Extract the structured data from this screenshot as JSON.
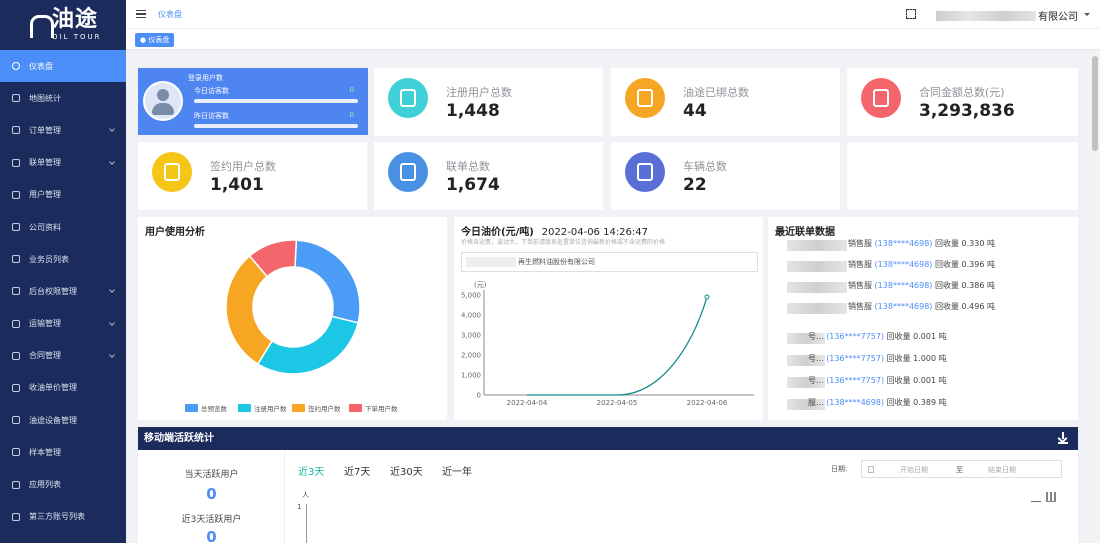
{
  "app": {
    "logo_text": "油途",
    "logo_sub": "OIL TOUR"
  },
  "sidebar": {
    "items": [
      {
        "label": "仪表盘",
        "icon": "dashboard-icon",
        "active": true,
        "expand": false
      },
      {
        "label": "地图统计",
        "icon": "map-icon",
        "expand": false
      },
      {
        "label": "订单管理",
        "icon": "order-icon",
        "expand": true
      },
      {
        "label": "联单管理",
        "icon": "manifest-icon",
        "expand": true
      },
      {
        "label": "用户管理",
        "icon": "user-icon",
        "expand": false
      },
      {
        "label": "公司资料",
        "icon": "company-icon",
        "expand": false
      },
      {
        "label": "业务员列表",
        "icon": "salesman-icon",
        "expand": false
      },
      {
        "label": "后台权限管理",
        "icon": "permission-icon",
        "expand": true
      },
      {
        "label": "运输管理",
        "icon": "truck-icon",
        "expand": true
      },
      {
        "label": "合同管理",
        "icon": "contract-icon",
        "expand": true
      },
      {
        "label": "收油单价管理",
        "icon": "price-icon",
        "expand": false
      },
      {
        "label": "油途设备管理",
        "icon": "device-icon",
        "expand": false
      },
      {
        "label": "样本管理",
        "icon": "sample-icon",
        "expand": false
      },
      {
        "label": "应用列表",
        "icon": "apps-icon",
        "expand": false
      },
      {
        "label": "第三方账号列表",
        "icon": "account-icon",
        "expand": false
      }
    ]
  },
  "header": {
    "breadcrumb": "仪表盘",
    "company_suffix": "有限公司",
    "tag": "仪表盘"
  },
  "login_card": {
    "title": "登录用户数",
    "today_label": "今日访客数",
    "today_value": "0",
    "yesterday_label": "昨日访客数",
    "yesterday_value": "0"
  },
  "stats": [
    {
      "label": "注册用户总数",
      "value": "1,448",
      "color": "#3fd0d8",
      "icon": "user-add-icon"
    },
    {
      "label": "油途已绑总数",
      "value": "44",
      "color": "#f5a623",
      "icon": "oil-drop-icon"
    },
    {
      "label": "合同金额总数(元)",
      "value": "3,293,836",
      "color": "#f4666b",
      "icon": "money-bag-icon"
    },
    {
      "label": "签约用户总数",
      "value": "1,401",
      "color": "#f5c518",
      "icon": "document-check-icon"
    },
    {
      "label": "联单总数",
      "value": "1,674",
      "color": "#4a90e2",
      "icon": "exchange-icon"
    },
    {
      "label": "车辆总数",
      "value": "22",
      "color": "#5a6fd6",
      "icon": "truck-icon"
    }
  ],
  "user_analysis": {
    "title": "用户使用分析"
  },
  "oil": {
    "title": "今日油价(元/吨)",
    "datetime": "2022-04-06 14:26:47",
    "note": "价格含运费，波动大，下单前请联系处置单位咨询最新价格或不含运费的价格",
    "company": "再生燃料油股份有限公司",
    "unit": "(元)"
  },
  "recent": {
    "title": "最近联单数据",
    "rows": [
      {
        "pre": "销售服",
        "phone": "(138****4698)",
        "text": "回收量 0.330 吨"
      },
      {
        "pre": "销售服",
        "phone": "(138****4698)",
        "text": "回收量 0.396 吨"
      },
      {
        "pre": "销售服",
        "phone": "(138****4698)",
        "text": "回收量 0.386 吨"
      },
      {
        "pre": "销售服",
        "phone": "(138****4698)",
        "text": "回收量 0.496 吨"
      },
      {
        "pre": "号...",
        "phone": "(136****7757)",
        "text": "回收量 0.001 吨"
      },
      {
        "pre": "号...",
        "phone": "(136****7757)",
        "text": "回收量 1.000 吨"
      },
      {
        "pre": "号...",
        "phone": "(136****7757)",
        "text": "回收量 0.001 吨"
      },
      {
        "pre": "服...",
        "phone": "(138****4698)",
        "text": "回收量 0.389 吨"
      }
    ]
  },
  "mobile": {
    "title": "移动端活跃统计",
    "today_label": "当天活跃用户",
    "today_value": "0",
    "three_label": "近3天活跃用户",
    "three_value": "0",
    "tabs": [
      "近3天",
      "近7天",
      "近30天",
      "近一年"
    ],
    "date_label": "日期:",
    "start_placeholder": "开始日期",
    "sep": "至",
    "end_placeholder": "结束日期",
    "chart_y_unit": "人",
    "chart_y_tick": "1"
  },
  "chart_data": [
    {
      "type": "pie",
      "title": "用户使用分析",
      "categories": [
        "总预览数",
        "注册用户数",
        "签约用户数",
        "下单用户数"
      ],
      "values": [
        28,
        30,
        30,
        12
      ],
      "colors": [
        "#4b9cf6",
        "#1cc7e6",
        "#f6a623",
        "#f4666b"
      ],
      "legend": "bottom"
    },
    {
      "type": "line",
      "title": "今日油价(元/吨)",
      "ylabel": "(元)",
      "x": [
        "2022-04-04",
        "2022-04-05",
        "2022-04-06"
      ],
      "ylim": [
        0,
        5000
      ],
      "yticks": [
        0,
        1000,
        2000,
        3000,
        4000,
        5000
      ],
      "series": [
        {
          "points": [
            [
              0,
              0
            ],
            [
              0.5,
              0
            ],
            [
              1.0,
              0
            ],
            [
              1.0,
              4900
            ]
          ]
        }
      ]
    }
  ]
}
